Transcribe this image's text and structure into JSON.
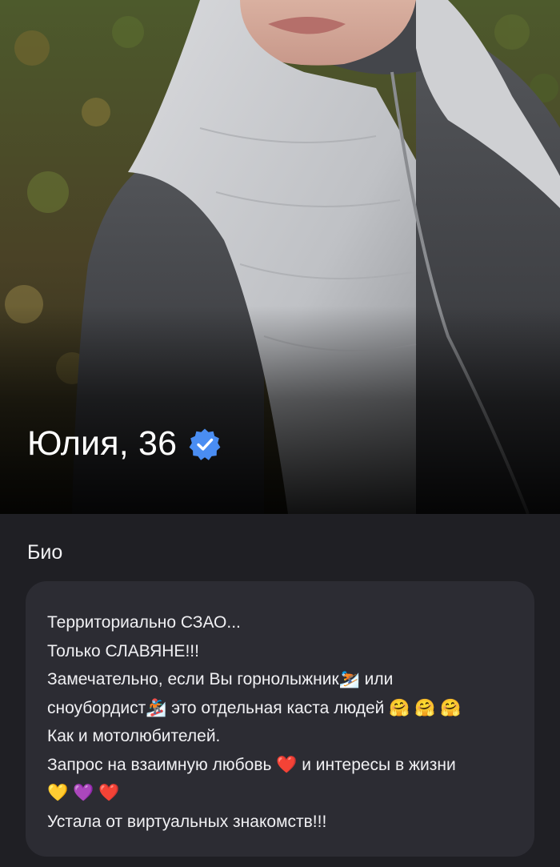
{
  "profile": {
    "name_age": "Юлия, 36",
    "verified_icon": "verified-badge-icon",
    "accent_color": "#4a8df2"
  },
  "bio": {
    "title": "Био",
    "lines": [
      "Территориально СЗАО...",
      "Только СЛАВЯНЕ!!!",
      "Замечательно, если Вы горнолыжник⛷️ или",
      "сноубордист🏂  это отдельная каста людей 🤗 🤗 🤗",
      "Как и мотолюбителей.",
      "Запрос на взаимную любовь ❤️ и интересы в жизни",
      "💛 💜 ❤️",
      "Устала от виртуальных знакомств!!!"
    ]
  },
  "colors": {
    "background": "#1f1f24",
    "card": "#2c2c33",
    "text": "#f0f0f3"
  }
}
